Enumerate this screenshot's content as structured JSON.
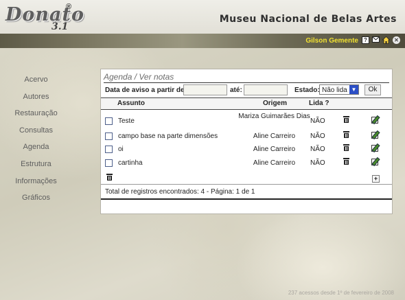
{
  "brand": {
    "logo": "Donato",
    "logo_version": "3.1",
    "registered": "®",
    "museum": "Museu Nacional de Belas Artes"
  },
  "user": {
    "name": "Gilson Gemente",
    "icons": [
      "help-icon",
      "mail-icon",
      "home-icon",
      "close-icon"
    ],
    "help_glyph": "?"
  },
  "sidebar": {
    "items": [
      {
        "label": "Acervo"
      },
      {
        "label": "Autores"
      },
      {
        "label": "Restauração"
      },
      {
        "label": "Consultas"
      },
      {
        "label": "Agenda"
      },
      {
        "label": "Estrutura"
      },
      {
        "label": "Informações"
      },
      {
        "label": "Gráficos"
      }
    ]
  },
  "panel": {
    "title": "Agenda / Ver notas",
    "filters": {
      "date_from_label": "Data de aviso a partir de:",
      "date_from_value": "",
      "date_to_label": "até:",
      "date_to_value": "",
      "status_label": "Estado:",
      "status_value": "Não lida",
      "ok_label": "Ok"
    },
    "columns": {
      "subject": "Assunto",
      "origin": "Origem",
      "read": "Lida ?"
    },
    "rows": [
      {
        "subject": "Teste",
        "origin": "Mariza Guimarães Dias",
        "read": "NÃO"
      },
      {
        "subject": "campo base na parte dimensões",
        "origin": "Aline Carreiro",
        "read": "NÃO"
      },
      {
        "subject": "oi",
        "origin": "Aline Carreiro",
        "read": "NÃO"
      },
      {
        "subject": "cartinha",
        "origin": "Aline Carreiro",
        "read": "NÃO"
      }
    ],
    "add_glyph": "+",
    "total": "Total de registros encontrados: 4 - Página: 1 de 1"
  },
  "footer": {
    "text": "237 acessos desde 1º de fevereiro de 2008"
  },
  "colors": {
    "username": "#f2e230",
    "select_arrow": "#2c4fc6",
    "checkbox_border": "#4b5d89"
  }
}
